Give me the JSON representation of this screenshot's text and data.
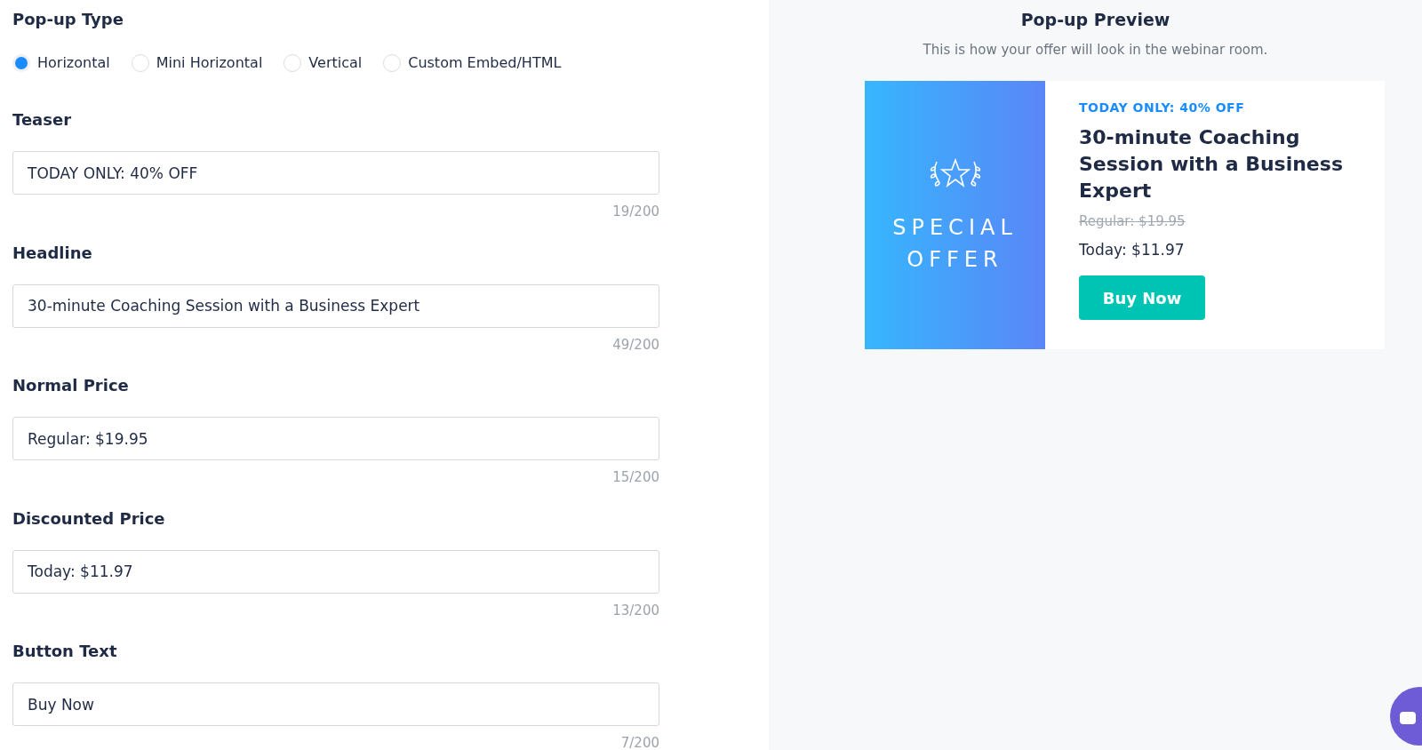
{
  "popup_type": {
    "label": "Pop-up Type",
    "options": [
      {
        "label": "Horizontal",
        "selected": true
      },
      {
        "label": "Mini Horizontal",
        "selected": false
      },
      {
        "label": "Vertical",
        "selected": false
      },
      {
        "label": "Custom Embed/HTML",
        "selected": false
      }
    ]
  },
  "fields": [
    {
      "label": "Teaser",
      "value": "TODAY ONLY: 40% OFF",
      "count": "19/200"
    },
    {
      "label": "Headline",
      "value": "30-minute Coaching Session with a Business Expert",
      "count": "49/200"
    },
    {
      "label": "Normal Price",
      "value": "Regular: $19.95",
      "count": "15/200"
    },
    {
      "label": "Discounted Price",
      "value": "Today: $11.97",
      "count": "13/200"
    },
    {
      "label": "Button Text",
      "value": "Buy Now",
      "count": "7/200"
    }
  ],
  "preview": {
    "title": "Pop-up Preview",
    "subtitle": "This is how your offer will look in the webinar room.",
    "image_lines": [
      "SPECIAL",
      "OFFER"
    ],
    "teaser": "TODAY ONLY: 40% OFF",
    "headline": "30-minute Coaching Session with a Business Expert",
    "regular_price": "Regular: $19.95",
    "today_price": "Today: $11.97",
    "button": "Buy Now"
  }
}
